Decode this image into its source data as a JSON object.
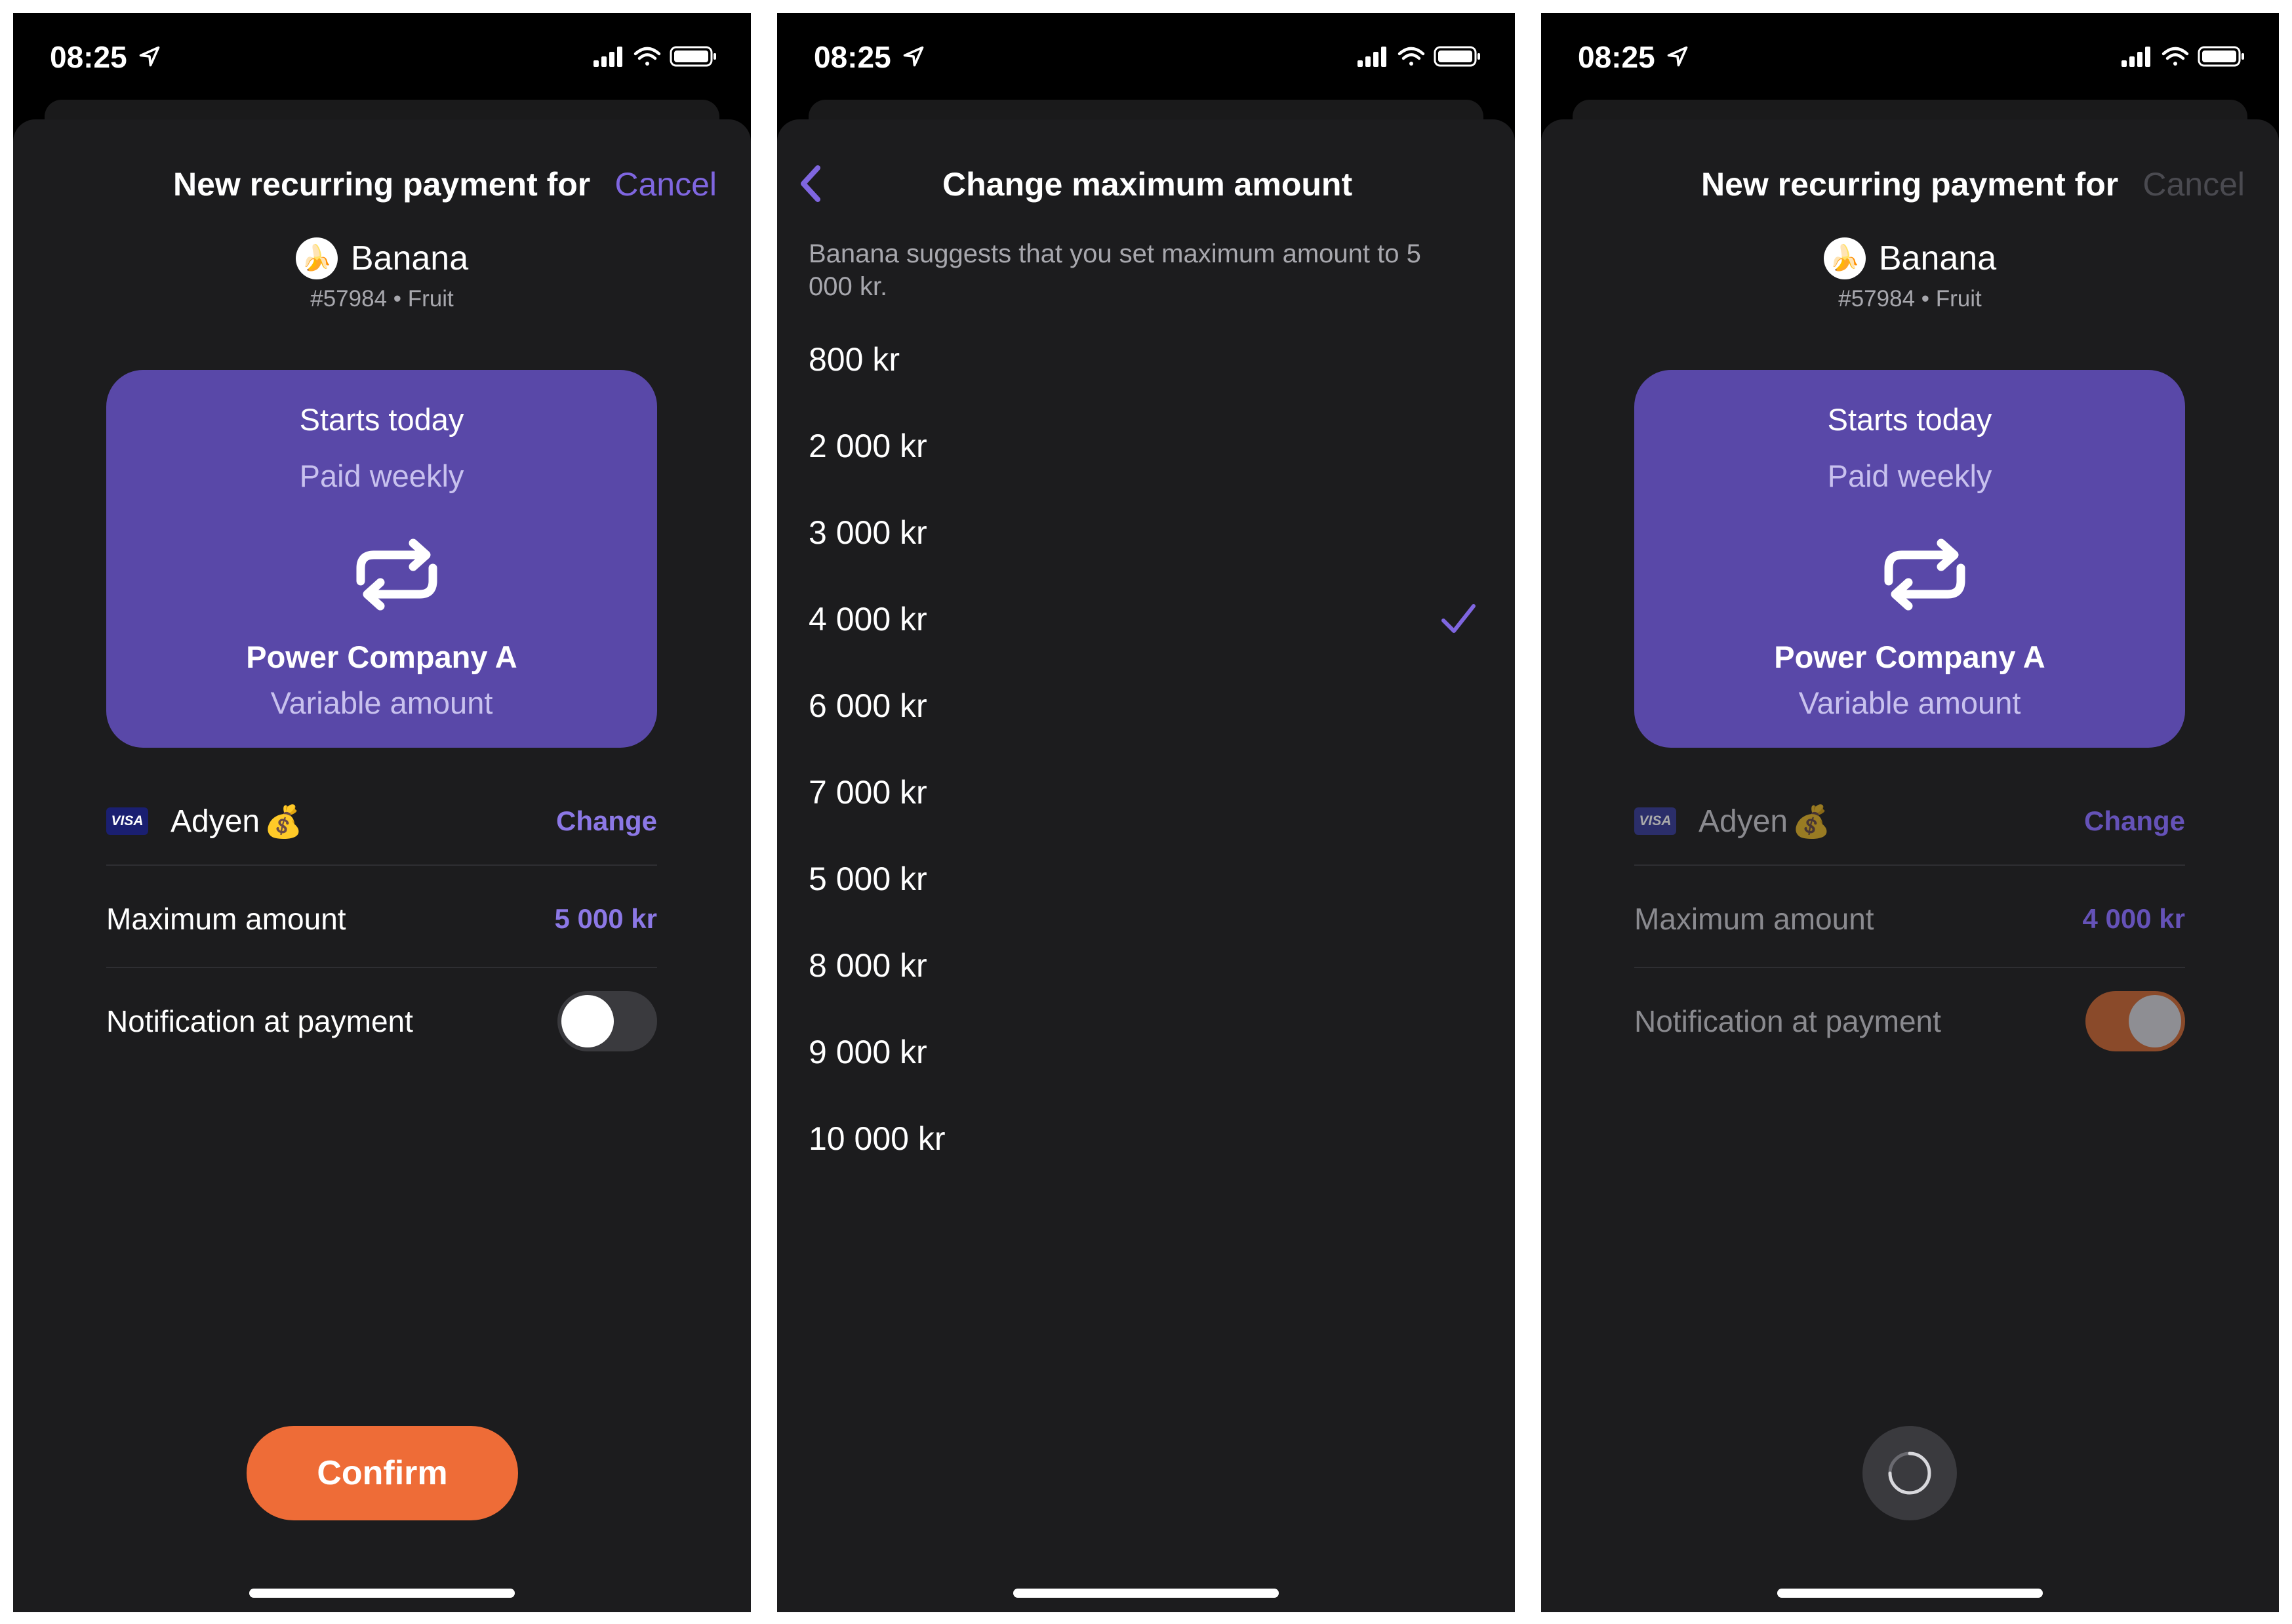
{
  "status_bar": {
    "time": "08:25"
  },
  "screen1": {
    "header": {
      "title": "New recurring payment for",
      "cancel": "Cancel"
    },
    "merchant": {
      "name": "Banana",
      "sub": "#57984 • Fruit",
      "logo_icon": "banana-icon"
    },
    "card": {
      "starts": "Starts today",
      "frequency": "Paid weekly",
      "icon": "repeat-icon",
      "company": "Power Company A",
      "amount_type": "Variable amount"
    },
    "payment_method": {
      "brand": "VISA",
      "name": "Adyen",
      "emoji": "💰",
      "change": "Change"
    },
    "max_amount": {
      "label": "Maximum amount",
      "value": "5 000 kr"
    },
    "notification": {
      "label": "Notification at payment",
      "on": false
    },
    "confirm": "Confirm"
  },
  "screen2": {
    "title": "Change maximum amount",
    "subtitle": "Banana suggests that you set maximum amount to 5 000 kr.",
    "options": [
      "800 kr",
      "2 000 kr",
      "3 000 kr",
      "4 000 kr",
      "6 000 kr",
      "7 000 kr",
      "5 000 kr",
      "8 000 kr",
      "9 000 kr",
      "10 000 kr"
    ],
    "selected": "4 000 kr"
  },
  "screen3": {
    "header": {
      "title": "New recurring payment for",
      "cancel": "Cancel"
    },
    "merchant": {
      "name": "Banana",
      "sub": "#57984 • Fruit",
      "logo_icon": "banana-icon"
    },
    "card": {
      "starts": "Starts today",
      "frequency": "Paid weekly",
      "icon": "repeat-icon",
      "company": "Power Company A",
      "amount_type": "Variable amount"
    },
    "payment_method": {
      "brand": "VISA",
      "name": "Adyen",
      "emoji": "💰",
      "change": "Change"
    },
    "max_amount": {
      "label": "Maximum amount",
      "value": "4 000 kr"
    },
    "notification": {
      "label": "Notification at payment",
      "on": true
    },
    "loading": true
  },
  "colors": {
    "accent": "#7f66e0",
    "card": "#5948a8",
    "confirm": "#ee6c37",
    "sheet": "#1c1c1e",
    "toggle_on": "#8a4a2a"
  }
}
